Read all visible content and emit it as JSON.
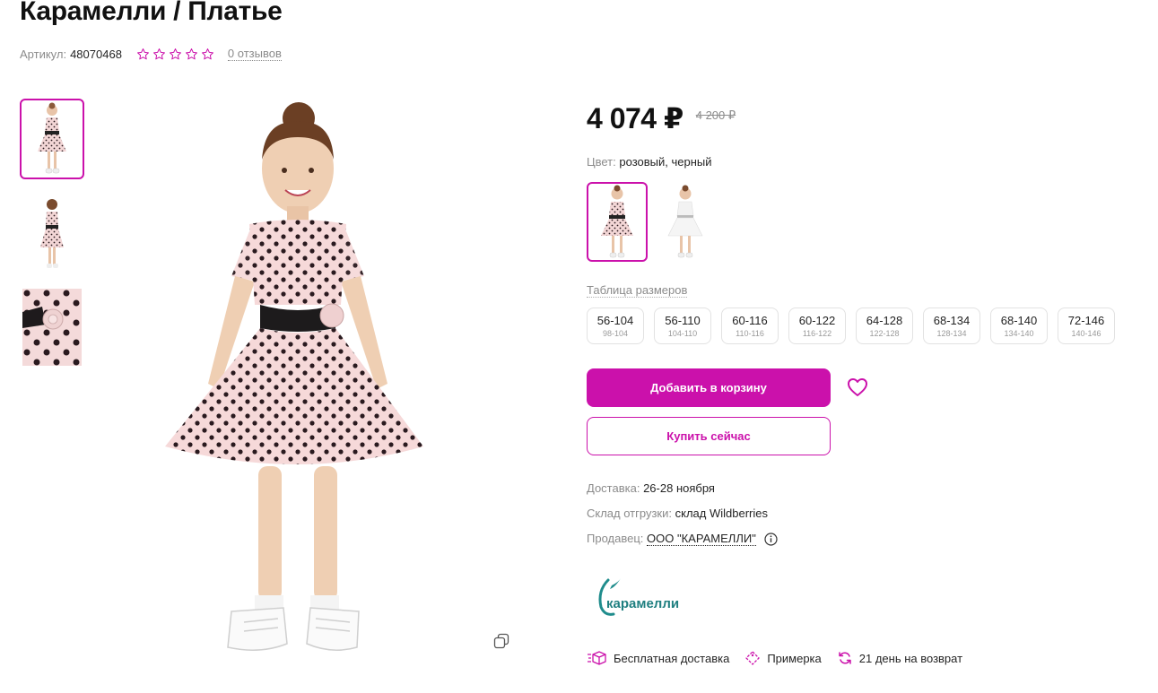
{
  "product": {
    "title": "Карамелли / Платье",
    "article_label": "Артикул:",
    "article": "48070468",
    "rating_stars": 0,
    "reviews": "0 отзывов"
  },
  "gallery": {
    "thumbs": [
      "dress-front",
      "dress-back",
      "fabric-closeup"
    ],
    "active_index": 0
  },
  "price": {
    "current": "4 074 ₽",
    "old": "4 200 ₽"
  },
  "color": {
    "label": "Цвет:",
    "value": "розовый, черный",
    "options": [
      "pink-polka-dot",
      "white"
    ]
  },
  "sizes": {
    "table_link": "Таблица размеров",
    "items": [
      {
        "main": "56-104",
        "sub": "98-104"
      },
      {
        "main": "56-110",
        "sub": "104-110"
      },
      {
        "main": "60-116",
        "sub": "110-116"
      },
      {
        "main": "60-122",
        "sub": "116-122"
      },
      {
        "main": "64-128",
        "sub": "122-128"
      },
      {
        "main": "68-134",
        "sub": "128-134"
      },
      {
        "main": "68-140",
        "sub": "134-140"
      },
      {
        "main": "72-146",
        "sub": "140-146"
      }
    ]
  },
  "actions": {
    "add_to_cart": "Добавить в корзину",
    "buy_now": "Купить сейчас"
  },
  "delivery": {
    "label": "Доставка:",
    "value": "26-28 ноября"
  },
  "warehouse": {
    "label": "Склад отгрузки:",
    "value": "склад Wildberries"
  },
  "seller": {
    "label": "Продавец:",
    "value": "ООО \"КАРАМЕЛЛИ\"",
    "brand_logo_text": "карамелли"
  },
  "perks": [
    {
      "icon": "box-icon",
      "label": "Бесплатная доставка"
    },
    {
      "icon": "tag-icon",
      "label": "Примерка"
    },
    {
      "icon": "return-icon",
      "label": "21 день на возврат"
    }
  ],
  "colors": {
    "accent": "#cb11ab",
    "text": "#242424",
    "muted": "#8b8b8b"
  }
}
